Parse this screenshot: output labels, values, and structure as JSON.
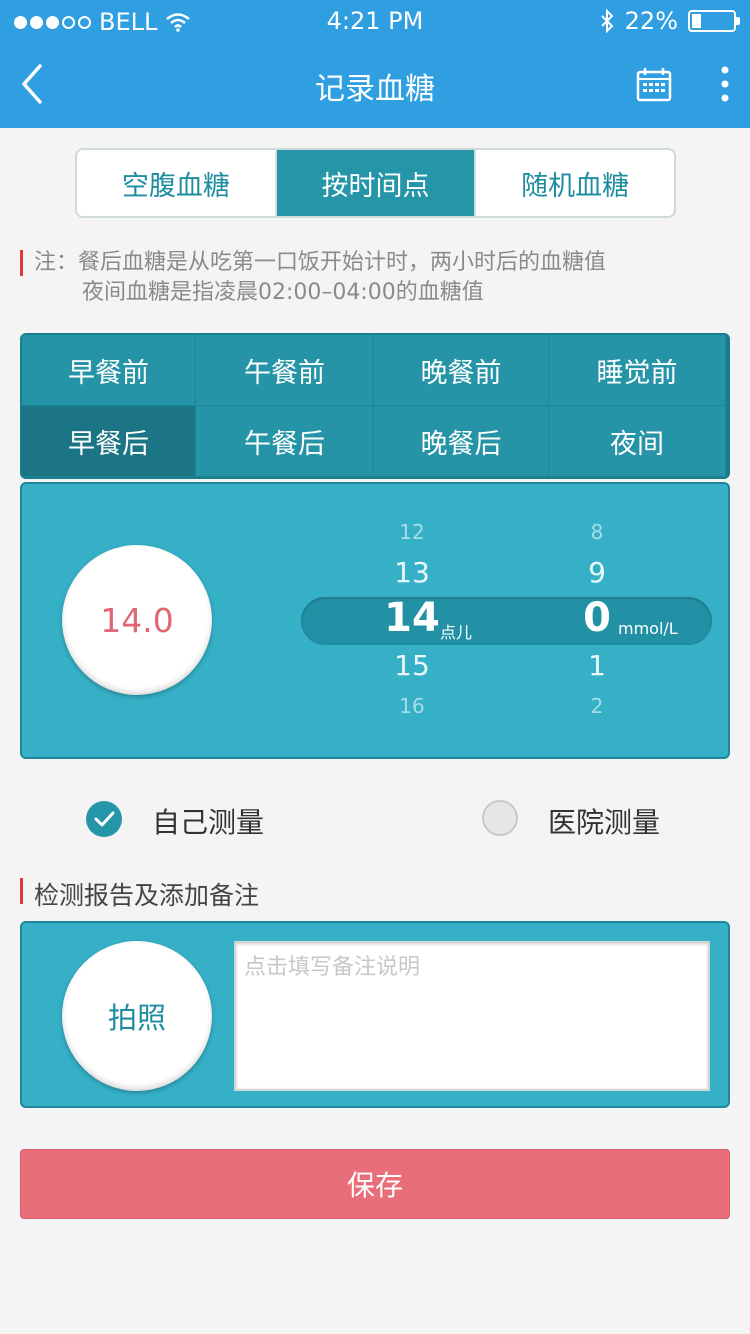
{
  "status_bar": {
    "carrier": "BELL",
    "time": "4:21 PM",
    "battery_text": "22%",
    "battery_level": 0.22
  },
  "nav": {
    "title": "记录血糖",
    "back_icon": "chevron-left-icon",
    "calendar_icon": "calendar-icon",
    "more_icon": "more-vertical-icon"
  },
  "tabs": {
    "items": [
      "空腹血糖",
      "按时间点",
      "随机血糖"
    ],
    "selected": "按时间点"
  },
  "note": {
    "line1": "注：餐后血糖是从吃第一口饭开始计时，两小时后的血糖值",
    "line2": "夜间血糖是指凌晨02:00–04:00的血糖值"
  },
  "time_slots": {
    "row1": [
      "早餐前",
      "午餐前",
      "晚餐前",
      "睡觉前"
    ],
    "row2": [
      "早餐后",
      "午餐后",
      "晚餐后",
      "夜间"
    ],
    "selected": "早餐后"
  },
  "value": {
    "display": "14.0",
    "integer_wheel": [
      "12",
      "13",
      "14",
      "15",
      "16"
    ],
    "decimal_wheel": [
      "8",
      "9",
      "0",
      "1",
      "2"
    ],
    "point_label": "点儿",
    "unit": "mmol/L"
  },
  "measure": {
    "self_label": "自己测量",
    "hospital_label": "医院测量",
    "selected": "self"
  },
  "remarks": {
    "section_title": "检测报告及添加备注",
    "photo_label": "拍照",
    "placeholder": "点击填写备注说明",
    "value": ""
  },
  "save_label": "保存",
  "colors": {
    "header": "#2f9fe2",
    "teal": "#2596a8",
    "panel": "#35b0c7",
    "save": "#e86e7a",
    "accent_red": "#e23a3a"
  }
}
